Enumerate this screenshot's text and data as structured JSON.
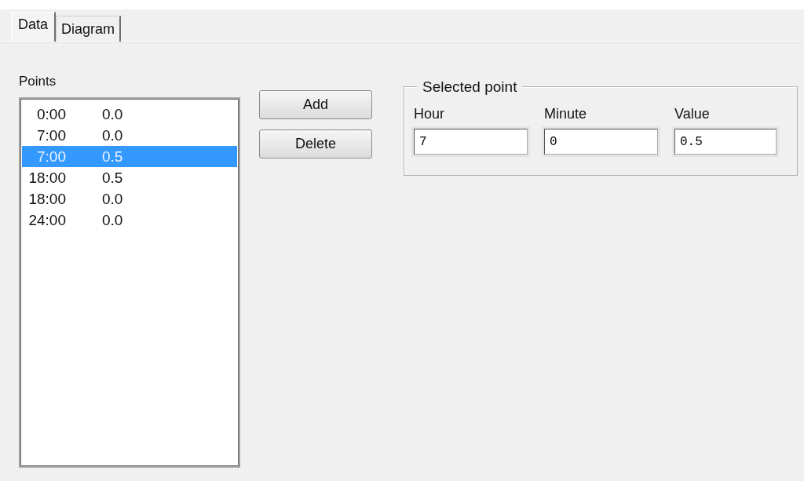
{
  "tabs": [
    {
      "label": "Data",
      "selected": true
    },
    {
      "label": "Diagram",
      "selected": false
    }
  ],
  "points": {
    "label": "Points",
    "items": [
      {
        "hour": "0:00",
        "value": "0.0",
        "selected": false
      },
      {
        "hour": "7:00",
        "value": "0.0",
        "selected": false
      },
      {
        "hour": "7:00",
        "value": "0.5",
        "selected": true
      },
      {
        "hour": "18:00",
        "value": "0.5",
        "selected": false
      },
      {
        "hour": "18:00",
        "value": "0.0",
        "selected": false
      },
      {
        "hour": "24:00",
        "value": "0.0",
        "selected": false
      }
    ]
  },
  "buttons": [
    "Add",
    "Delete"
  ],
  "selected_point": {
    "title": "Selected point",
    "fields": [
      {
        "label": "Hour",
        "value": "7"
      },
      {
        "label": "Minute",
        "value": "0"
      },
      {
        "label": "Value",
        "value": "0.5"
      }
    ]
  }
}
